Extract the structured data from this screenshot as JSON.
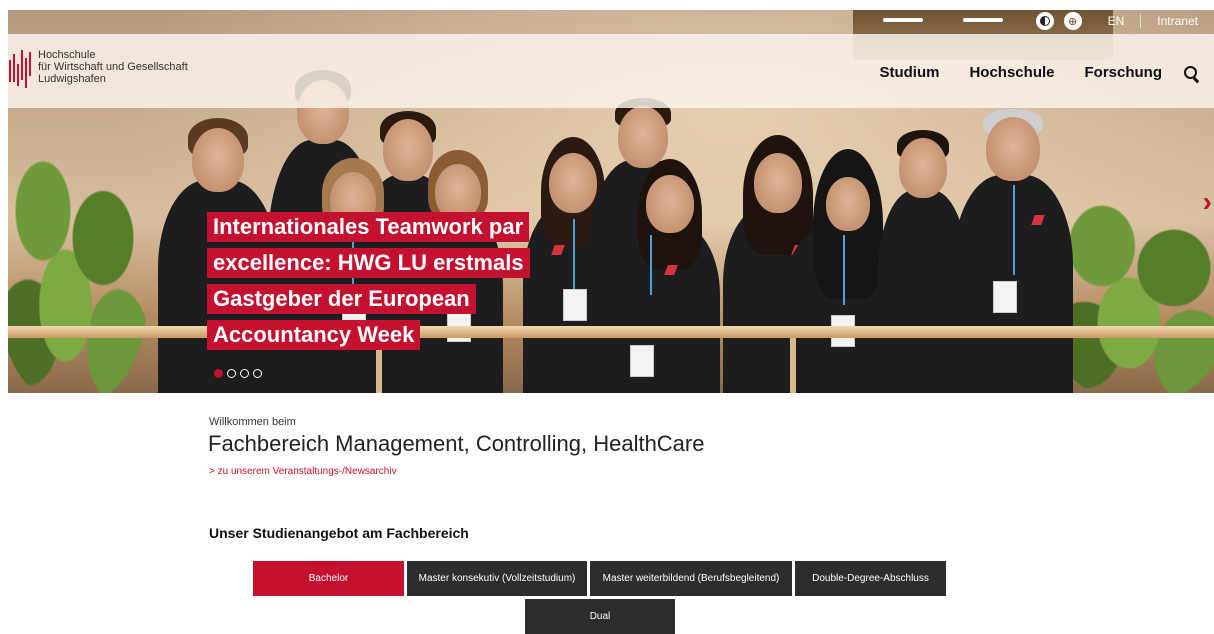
{
  "utility": {
    "contrast_icon": "contrast-icon",
    "accessibility_icon": "accessibility-icon",
    "accessibility_glyph": "⊕",
    "lang": "EN",
    "intranet": "Intranet"
  },
  "logo": {
    "line1": "Hochschule",
    "line2": "für Wirtschaft und Gesellschaft",
    "line3": "Ludwigshafen"
  },
  "nav": {
    "items": [
      "Studium",
      "Hochschule",
      "Forschung"
    ],
    "search_icon": "search-icon"
  },
  "hero": {
    "headline_lines": [
      "Internationales Teamwork par",
      "excellence: HWG LU erstmals",
      "Gastgeber der European",
      "Accountancy Week"
    ],
    "next_arrow": "›",
    "slide_count": 4,
    "active_slide": 1
  },
  "content": {
    "welcome": "Willkommen beim",
    "title": "Fachbereich Management, Controlling, HealthCare",
    "news_link": ">  zu unserem Veranstaltungs-/Newsarchiv",
    "section_title": "Unser Studienangebot am Fachbereich"
  },
  "tabs": [
    {
      "label": "Bachelor",
      "active": true
    },
    {
      "label": "Master konsekutiv (Vollzeitstudium)",
      "active": false
    },
    {
      "label": "Master weiterbildend (Berufsbegleitend)",
      "active": false
    },
    {
      "label": "Double-Degree-Abschluss",
      "active": false
    },
    {
      "label": "Dual",
      "active": false
    }
  ],
  "colors": {
    "accent": "#c4112f",
    "tab_dark": "#2d2d2d"
  }
}
